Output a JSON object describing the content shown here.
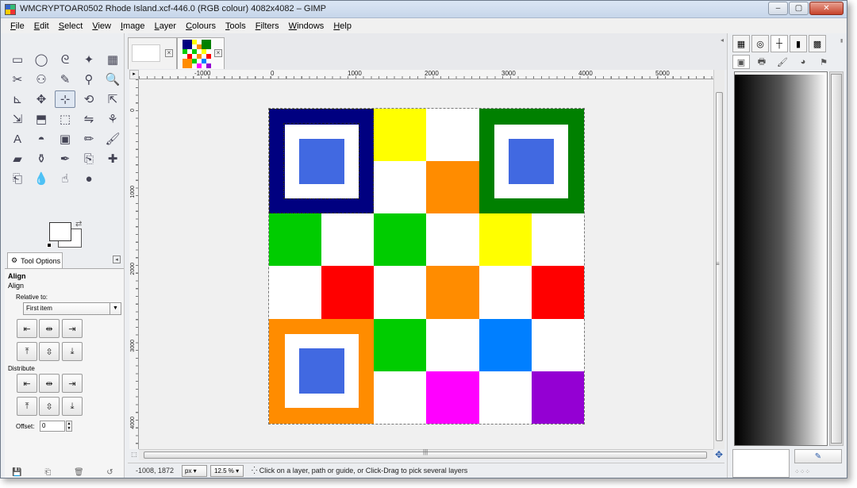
{
  "window": {
    "title": "WMCRYPTOAR0502 Rhode Island.xcf-446.0 (RGB colour) 4082x4082 – GIMP",
    "minimize": "–",
    "maximize": "▢",
    "close": "✕"
  },
  "menubar": [
    "File",
    "Edit",
    "Select",
    "View",
    "Image",
    "Layer",
    "Colours",
    "Tools",
    "Filters",
    "Windows",
    "Help"
  ],
  "tools": [
    "rect-select-icon",
    "ellipse-select-icon",
    "free-select-icon",
    "fuzzy-select-icon",
    "select-by-color-icon",
    "scissors-icon",
    "foreground-select-icon",
    "paths-icon",
    "color-picker-icon",
    "zoom-icon",
    "measure-icon",
    "move-icon",
    "align-icon",
    "transform-icon",
    "rotate-icon",
    "scale-icon",
    "shear-icon",
    "perspective-icon",
    "flip-icon",
    "cage-icon",
    "text-icon",
    "bucket-fill-icon",
    "blend-icon",
    "pencil-icon",
    "paintbrush-icon",
    "eraser-icon",
    "airbrush-icon",
    "ink-icon",
    "clone-icon",
    "heal-icon",
    "perspective-clone-icon",
    "blur-icon",
    "smudge-icon",
    "dodge-burn-icon"
  ],
  "tool_glyphs": [
    "▭",
    "◯",
    "ᘓ",
    "✦",
    "▦",
    "✂",
    "⚇",
    "✎",
    "⚲",
    "🔍",
    "⊾",
    "✥",
    "⊹",
    "⟲",
    "⇱",
    "⇲",
    "⬒",
    "⬚",
    "⇋",
    "⚘",
    "A",
    "◓",
    "▣",
    "✏",
    "🖌",
    "▰",
    "⚱",
    "✒",
    "⎘",
    "✚",
    "⎗",
    "💧",
    "☝",
    "●"
  ],
  "tool_options": {
    "tab_label": "Tool Options",
    "heading": "Align",
    "sub": "Align",
    "relative_label": "Relative to:",
    "relative_value": "First item",
    "distribute_label": "Distribute",
    "offset_label": "Offset:",
    "offset_value": "0",
    "align_glyphs": [
      "⇤",
      "⇹",
      "⇥",
      "⤒",
      "⇳",
      "⤓"
    ],
    "distribute_glyphs": [
      "⇤",
      "⇹",
      "⇥",
      "⤒",
      "⇳",
      "⤓"
    ]
  },
  "rulers": {
    "h_labels": [
      "-1000",
      "0",
      "1000",
      "2000",
      "3000",
      "4000",
      "5000"
    ],
    "v_labels": [
      "0",
      "1000",
      "2000",
      "3000",
      "4000"
    ]
  },
  "image_grid": {
    "cells": [
      "#000080",
      "#000080",
      "#ffff00",
      "#ffffff",
      "#008000",
      "#008000",
      "#000080",
      "#000080",
      "#ffffff",
      "#ff8c00",
      "#008000",
      "#008000",
      "#00cc00",
      "#ffffff",
      "#00cc00",
      "#ffffff",
      "#ffff00",
      "#ffffff",
      "#ffffff",
      "#ff0000",
      "#ffffff",
      "#ff8c00",
      "#ffffff",
      "#ff0000",
      "#ff8c00",
      "#ff8c00",
      "#00cc00",
      "#ffffff",
      "#007fff",
      "#ffffff",
      "#ff8c00",
      "#ff8c00",
      "#ffffff",
      "#ff00ff",
      "#ffffff",
      "#9400d3"
    ],
    "corner_blocks": [
      {
        "name": "top-left",
        "color": "#000080"
      },
      {
        "name": "top-right",
        "color": "#008000"
      },
      {
        "name": "bottom-left",
        "color": "#ff8c00"
      }
    ],
    "core_color": "#4169e1"
  },
  "status": {
    "coords": "-1008, 1872",
    "unit": "px",
    "zoom": "12.5 %",
    "message": "Click on a layer, path or guide, or Click-Drag to pick several layers"
  }
}
